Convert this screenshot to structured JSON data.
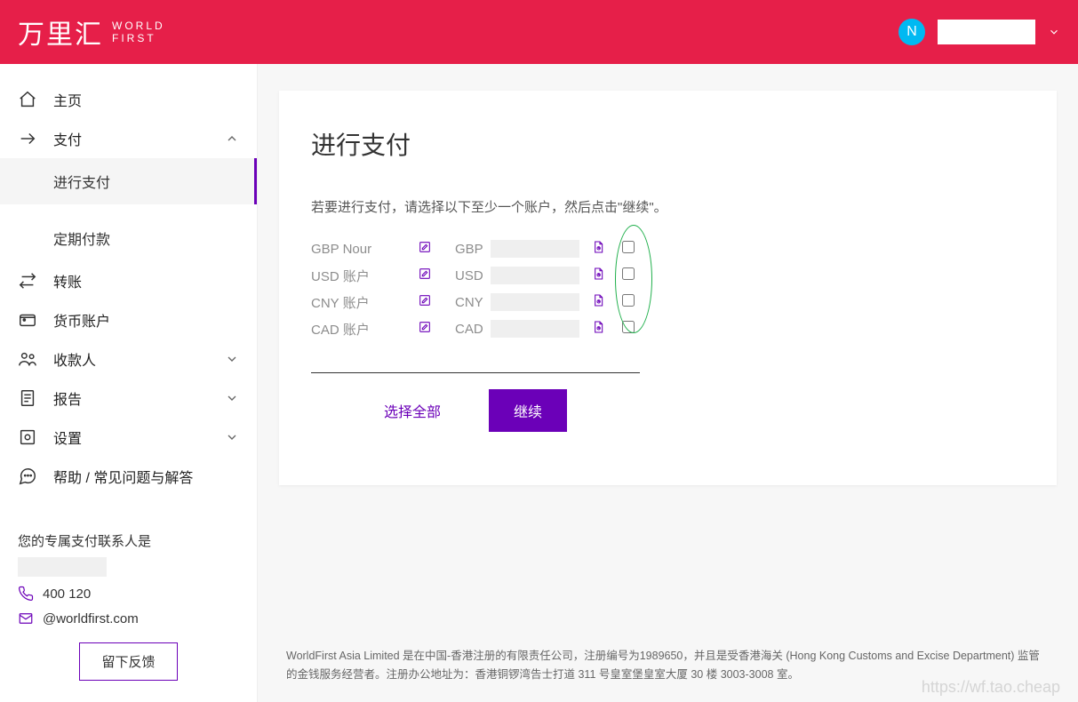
{
  "header": {
    "logo_cn": "万里汇",
    "logo_en_1": "WORLD",
    "logo_en_2": "FIRST",
    "avatar_letter": "N"
  },
  "sidebar": {
    "items": [
      {
        "key": "home",
        "label": "主页",
        "icon": "home-icon",
        "expandable": false
      },
      {
        "key": "pay",
        "label": "支付",
        "icon": "arrow-right-icon",
        "expandable": true,
        "expanded": true,
        "children": [
          {
            "key": "make-payment",
            "label": "进行支付",
            "active": true
          },
          {
            "key": "recurring",
            "label": "定期付款",
            "active": false
          }
        ]
      },
      {
        "key": "transfer",
        "label": "转账",
        "icon": "swap-icon",
        "expandable": false
      },
      {
        "key": "currency",
        "label": "货币账户",
        "icon": "wallet-icon",
        "expandable": false
      },
      {
        "key": "payee",
        "label": "收款人",
        "icon": "people-icon",
        "expandable": true
      },
      {
        "key": "report",
        "label": "报告",
        "icon": "report-icon",
        "expandable": true
      },
      {
        "key": "settings",
        "label": "设置",
        "icon": "gear-icon",
        "expandable": true
      },
      {
        "key": "help",
        "label": "帮助 / 常见问题与解答",
        "icon": "chat-icon",
        "expandable": false
      }
    ],
    "contact": {
      "title": "您的专属支付联系人是",
      "phone": "400 120",
      "email": "@worldfirst.com",
      "feedback_button": "留下反馈"
    }
  },
  "main": {
    "title": "进行支付",
    "hint": "若要进行支付，请选择以下至少一个账户，然后点击\"继续\"。",
    "accounts": [
      {
        "name": "GBP Nour",
        "ccy": "GBP"
      },
      {
        "name": "USD 账户",
        "ccy": "USD"
      },
      {
        "name": "CNY 账户",
        "ccy": "CNY"
      },
      {
        "name": "CAD 账户",
        "ccy": "CAD"
      }
    ],
    "select_all": "选择全部",
    "continue": "继续"
  },
  "footer": {
    "text": "WorldFirst Asia Limited 是在中国-香港注册的有限责任公司，注册编号为1989650，并且是受香港海关 (Hong Kong Customs and Excise Department) 监管的金钱服务经营者。注册办公地址为：香港铜锣湾告士打道 311 号皇室堡皇室大厦 30 楼 3003-3008 室。"
  },
  "watermark": "https://wf.tao.cheap"
}
